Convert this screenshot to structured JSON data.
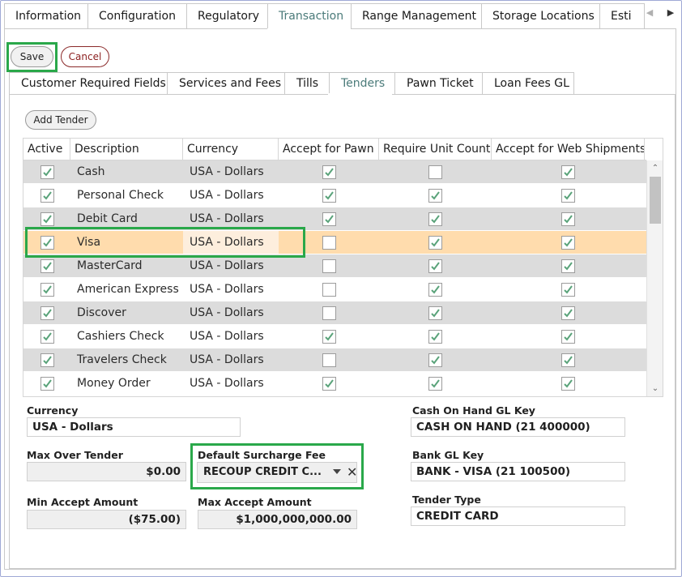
{
  "top_tabs": [
    {
      "label": "Information"
    },
    {
      "label": "Configuration"
    },
    {
      "label": "Regulatory"
    },
    {
      "label": "Transaction"
    },
    {
      "label": "Range Management"
    },
    {
      "label": "Storage Locations"
    },
    {
      "label": "Esti"
    }
  ],
  "toolbar": {
    "save_label": "Save",
    "cancel_label": "Cancel"
  },
  "sub_tabs": [
    {
      "label": "Customer Required Fields"
    },
    {
      "label": "Services and Fees"
    },
    {
      "label": "Tills"
    },
    {
      "label": "Tenders"
    },
    {
      "label": "Pawn Ticket"
    },
    {
      "label": "Loan Fees GL"
    }
  ],
  "grid": {
    "add_label": "Add Tender",
    "columns": [
      "Active",
      "Description",
      "Currency",
      "Accept for Pawn",
      "Require Unit Count",
      "Accept for Web Shipments"
    ],
    "rows": [
      {
        "active": true,
        "description": "Cash",
        "currency": "USA - Dollars",
        "pawn": true,
        "unit": false,
        "web": true
      },
      {
        "active": true,
        "description": "Personal Check",
        "currency": "USA - Dollars",
        "pawn": true,
        "unit": true,
        "web": true
      },
      {
        "active": true,
        "description": "Debit Card",
        "currency": "USA - Dollars",
        "pawn": true,
        "unit": true,
        "web": true
      },
      {
        "active": true,
        "description": "Visa",
        "currency": "USA - Dollars",
        "pawn": false,
        "unit": true,
        "web": true
      },
      {
        "active": true,
        "description": "MasterCard",
        "currency": "USA - Dollars",
        "pawn": false,
        "unit": true,
        "web": true
      },
      {
        "active": true,
        "description": "American Express",
        "currency": "USA - Dollars",
        "pawn": false,
        "unit": true,
        "web": true
      },
      {
        "active": true,
        "description": "Discover",
        "currency": "USA - Dollars",
        "pawn": false,
        "unit": true,
        "web": true
      },
      {
        "active": true,
        "description": "Cashiers Check",
        "currency": "USA - Dollars",
        "pawn": true,
        "unit": true,
        "web": true
      },
      {
        "active": true,
        "description": "Travelers Check",
        "currency": "USA - Dollars",
        "pawn": false,
        "unit": true,
        "web": true
      },
      {
        "active": true,
        "description": "Money Order",
        "currency": "USA - Dollars",
        "pawn": true,
        "unit": true,
        "web": true
      }
    ]
  },
  "details": {
    "currency_label": "Currency",
    "currency_value": "USA - Dollars",
    "max_over_tender_label": "Max Over Tender",
    "max_over_tender_value": "$0.00",
    "default_surcharge_label": "Default Surcharge Fee",
    "default_surcharge_value": "RECOUP CREDIT C...",
    "min_accept_label": "Min Accept Amount",
    "min_accept_value": "($75.00)",
    "max_accept_label": "Max Accept Amount",
    "max_accept_value": "$1,000,000,000.00",
    "cash_on_hand_label": "Cash On Hand GL Key",
    "cash_on_hand_value": "CASH ON HAND (21 400000)",
    "bank_gl_label": "Bank GL Key",
    "bank_gl_value": "BANK - VISA (21 100500)",
    "tender_type_label": "Tender Type",
    "tender_type_value": "CREDIT CARD"
  },
  "colors": {
    "highlight": "#2aa84a",
    "selected_row": "#ffdcad",
    "checkmark": "#5aa37a",
    "active_tab": "#4b7b7a"
  }
}
